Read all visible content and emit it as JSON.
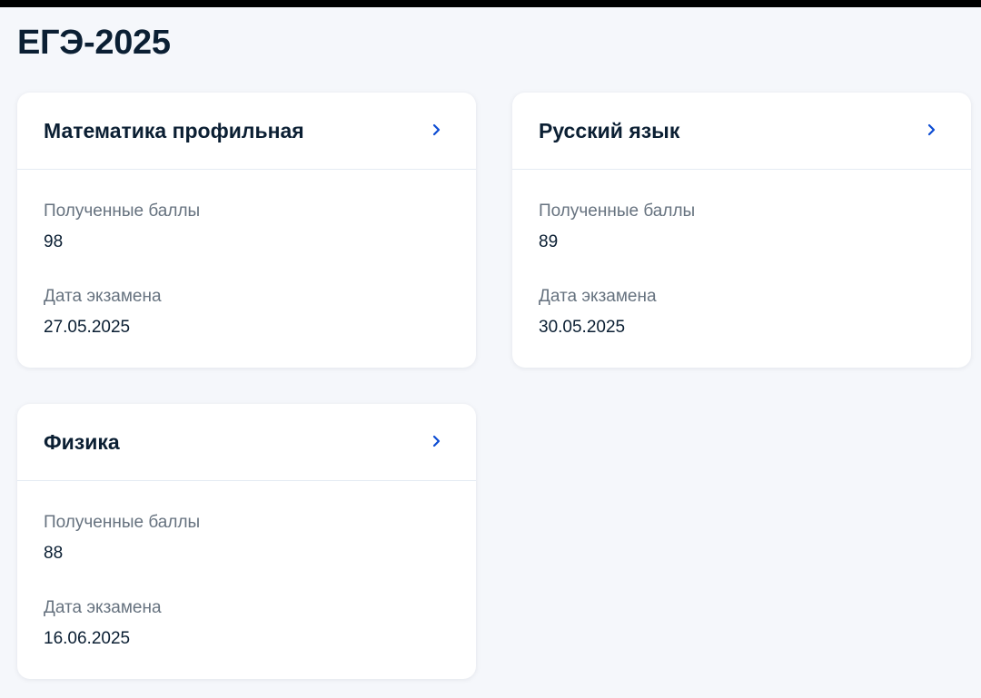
{
  "page": {
    "title": "ЕГЭ-2025"
  },
  "colors": {
    "background": "#f5f7fb",
    "card": "#ffffff",
    "text_primary": "#0b1f33",
    "text_secondary": "#66727f",
    "accent": "#0d4cd3"
  },
  "cards": [
    {
      "subject": "Математика профильная",
      "score_label": "Полученные баллы",
      "score": "98",
      "date_label": "Дата экзамена",
      "date": "27.05.2025",
      "icon": "chevron-right-icon"
    },
    {
      "subject": "Русский язык",
      "score_label": "Полученные баллы",
      "score": "89",
      "date_label": "Дата экзамена",
      "date": "30.05.2025",
      "icon": "chevron-right-icon"
    },
    {
      "subject": "Физика",
      "score_label": "Полученные баллы",
      "score": "88",
      "date_label": "Дата экзамена",
      "date": "16.06.2025",
      "icon": "chevron-right-icon"
    }
  ]
}
